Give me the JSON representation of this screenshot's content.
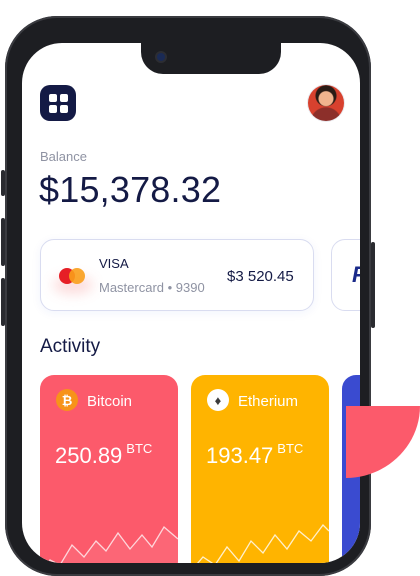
{
  "header": {
    "menu_icon": "grid-icon",
    "avatar_icon": "user-avatar"
  },
  "balance": {
    "label": "Balance",
    "amount": "$15,378.32"
  },
  "card": {
    "name": "VISA",
    "number": "Mastercard • 9390",
    "amount": "$3 520.45",
    "logo_icon": "mastercard-icon"
  },
  "card_secondary": {
    "logo": "P"
  },
  "activity": {
    "title": "Activity",
    "assets": [
      {
        "name": "Bitcoin",
        "icon": "₿",
        "value": "250.89",
        "unit": "BTC",
        "color": "#fc5a6b"
      },
      {
        "name": "Etherium",
        "icon": "♦",
        "value": "193.47",
        "unit": "BTC",
        "color": "#ffb400"
      }
    ]
  },
  "colors": {
    "primary": "#141a45",
    "accent_red": "#fc5a6b",
    "accent_yellow": "#ffb400",
    "accent_blue": "#3a4bd0"
  }
}
